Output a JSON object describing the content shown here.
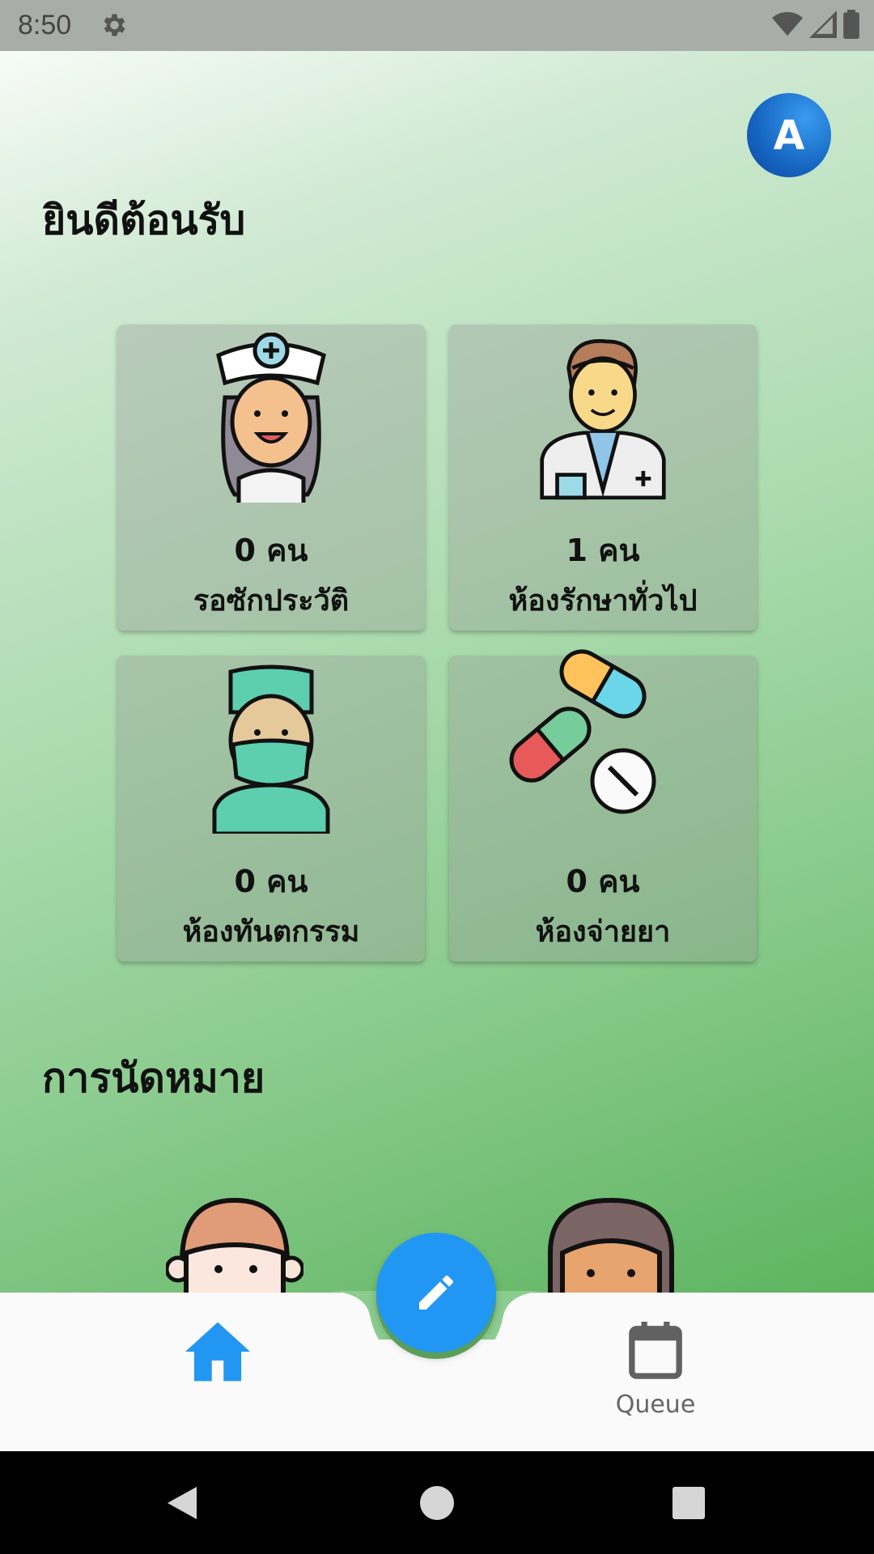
{
  "status": {
    "time": "8:50"
  },
  "header": {
    "avatar_letter": "A",
    "welcome": "ยินดีต้อนรับ"
  },
  "cards": [
    {
      "count": "0 คน",
      "label": "รอซักประวัติ",
      "icon": "nurse-icon"
    },
    {
      "count": "1 คน",
      "label": "ห้องรักษาทั่วไป",
      "icon": "doctor-icon"
    },
    {
      "count": "0 คน",
      "label": "ห้องทันตกรรม",
      "icon": "dentist-icon"
    },
    {
      "count": "0 คน",
      "label": "ห้องจ่ายยา",
      "icon": "pills-icon"
    }
  ],
  "appointments": {
    "heading": "การนัดหมาย"
  },
  "bottom_nav": {
    "home_icon": "home-icon",
    "queue_label": "Queue",
    "fab_icon": "edit-icon"
  },
  "colors": {
    "accent": "#2196f3",
    "avatar": "#1565c0"
  }
}
